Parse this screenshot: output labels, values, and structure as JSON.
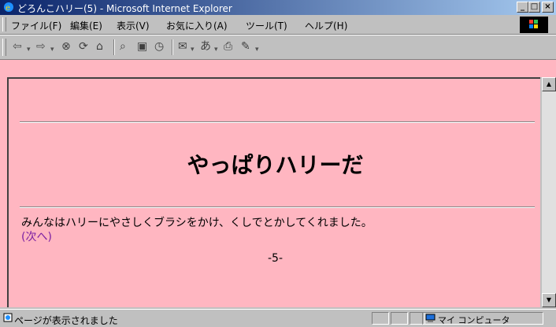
{
  "window": {
    "title": "どろんこハリー(5) - Microsoft Internet Explorer"
  },
  "menu": [
    "ファイル(F)",
    "編集(E)",
    "表示(V)",
    "お気に入り(A)",
    "ツール(T)",
    "ヘルプ(H)"
  ],
  "page": {
    "heading": "やっぱりハリーだ",
    "paragraph": "みんなはハリーにやさしくブラシをかけ、くしでとかしてくれました。",
    "next_link": "(次へ)",
    "page_number": "-5-"
  },
  "status": {
    "text": "ページが表示されました",
    "zone": "マイ コンピュータ"
  },
  "colors": {
    "content_bg": "#ffb6c1",
    "link": "#7b1fa2",
    "title_bar": "#0a246a"
  }
}
